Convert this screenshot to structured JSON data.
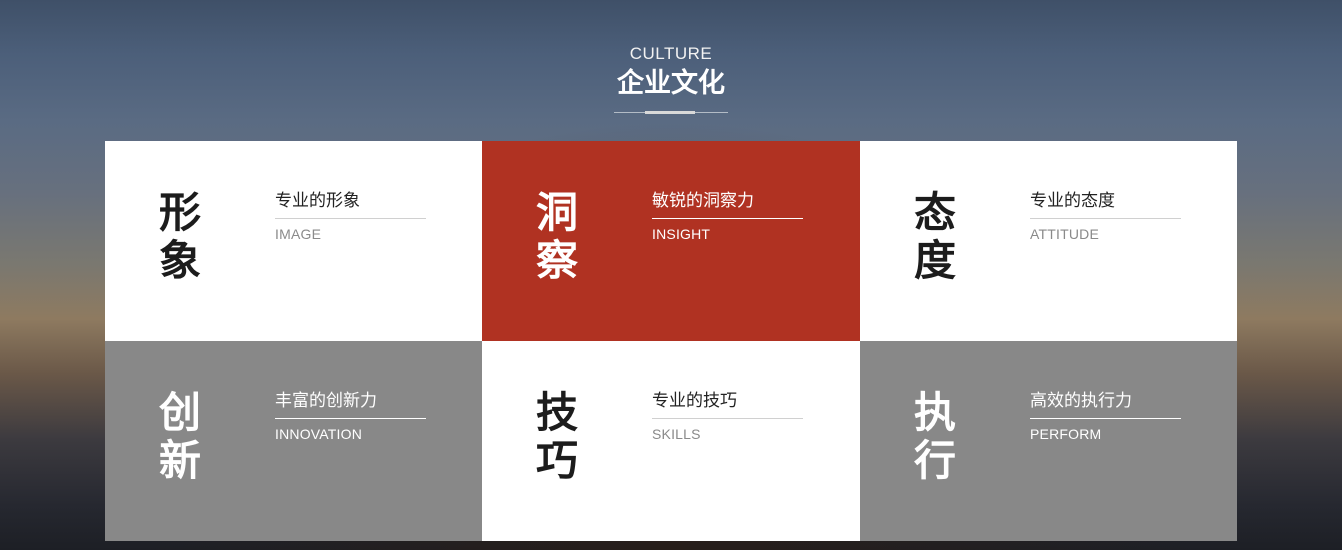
{
  "header": {
    "subtitle": "CULTURE",
    "title": "企业文化"
  },
  "colors": {
    "accent_red": "#b03222",
    "card_gray": "#888888",
    "card_white": "#ffffff"
  },
  "cards": [
    {
      "glyph_1": "形",
      "glyph_2": "象",
      "title": "专业的形象",
      "en": "IMAGE",
      "style": "white"
    },
    {
      "glyph_1": "洞",
      "glyph_2": "察",
      "title": "敏锐的洞察力",
      "en": "INSIGHT",
      "style": "red"
    },
    {
      "glyph_1": "态",
      "glyph_2": "度",
      "title": "专业的态度",
      "en": "ATTITUDE",
      "style": "white"
    },
    {
      "glyph_1": "创",
      "glyph_2": "新",
      "title": "丰富的创新力",
      "en": "INNOVATION",
      "style": "gray"
    },
    {
      "glyph_1": "技",
      "glyph_2": "巧",
      "title": "专业的技巧",
      "en": "SKILLS",
      "style": "white"
    },
    {
      "glyph_1": "执",
      "glyph_2": "行",
      "title": "高效的执行力",
      "en": "PERFORM",
      "style": "gray"
    }
  ]
}
